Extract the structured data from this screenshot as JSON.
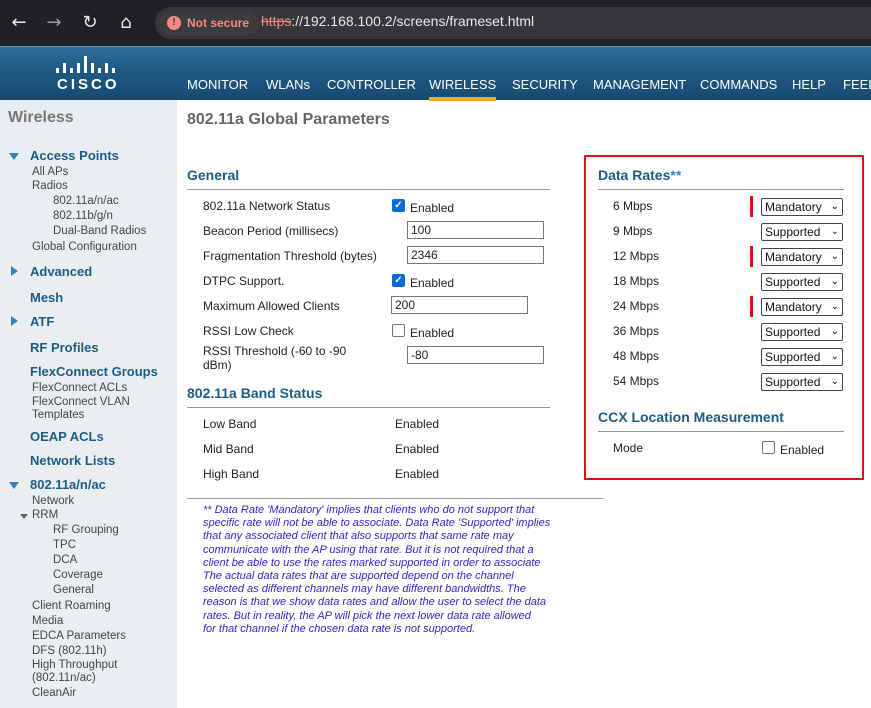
{
  "browser": {
    "not_secure": "Not secure",
    "url_scheme": "https",
    "url_rest": "://192.168.100.2/screens/frameset.html"
  },
  "logo_text": "CISCO",
  "topnav": [
    "MONITOR",
    "WLANs",
    "CONTROLLER",
    "WIRELESS",
    "SECURITY",
    "MANAGEMENT",
    "COMMANDS",
    "HELP",
    "FEED"
  ],
  "topnav_active": "WIRELESS",
  "sidebar": {
    "title": "Wireless",
    "access_points": "Access Points",
    "all_aps": "All APs",
    "radios": "Radios",
    "radio_a": "802.11a/n/ac",
    "radio_b": "802.11b/g/n",
    "radio_dual": "Dual-Band Radios",
    "global_config": "Global Configuration",
    "advanced": "Advanced",
    "mesh": "Mesh",
    "atf": "ATF",
    "rf_profiles": "RF Profiles",
    "flexconnect_groups": "FlexConnect Groups",
    "flexconnect_acls": "FlexConnect ACLs",
    "flexconnect_vlan": "FlexConnect VLAN",
    "templates": "Templates",
    "oeap_acls": "OEAP ACLs",
    "network_lists": "Network Lists",
    "band_a": "802.11a/n/ac",
    "network": "Network",
    "rrm": "RRM",
    "rf_grouping": "RF Grouping",
    "tpc": "TPC",
    "dca": "DCA",
    "coverage": "Coverage",
    "general": "General",
    "client_roaming": "Client Roaming",
    "media": "Media",
    "edca": "EDCA Parameters",
    "dfs": "DFS (802.11h)",
    "ht1": "High Throughput",
    "ht2": "(802.11n/ac)",
    "cleanair": "CleanAir"
  },
  "main": {
    "title": "802.11a Global Parameters",
    "general": {
      "heading": "General",
      "network_status_label": "802.11a Network Status",
      "network_status_text": "Enabled",
      "beacon_label": "Beacon Period (millisecs)",
      "beacon_value": "100",
      "frag_label": "Fragmentation Threshold (bytes)",
      "frag_value": "2346",
      "dtpc_label": "DTPC Support.",
      "dtpc_text": "Enabled",
      "max_clients_label": "Maximum Allowed Clients",
      "max_clients_value": "200",
      "rssi_low_label": "RSSI Low Check",
      "rssi_low_text": "Enabled",
      "rssi_thresh_label1": "RSSI Threshold (-60 to -90",
      "rssi_thresh_label2": "dBm)",
      "rssi_thresh_value": "-80"
    },
    "band_status": {
      "heading": "802.11a Band Status",
      "rows": [
        {
          "label": "Low Band",
          "value": "Enabled"
        },
        {
          "label": "Mid Band",
          "value": "Enabled"
        },
        {
          "label": "High Band",
          "value": "Enabled"
        }
      ]
    },
    "data_rates": {
      "heading": "Data Rates",
      "heading_suffix": "**",
      "rows": [
        {
          "rate": "6 Mbps",
          "value": "Mandatory"
        },
        {
          "rate": "9 Mbps",
          "value": "Supported"
        },
        {
          "rate": "12 Mbps",
          "value": "Mandatory"
        },
        {
          "rate": "18 Mbps",
          "value": "Supported"
        },
        {
          "rate": "24 Mbps",
          "value": "Mandatory"
        },
        {
          "rate": "36 Mbps",
          "value": "Supported"
        },
        {
          "rate": "48 Mbps",
          "value": "Supported"
        },
        {
          "rate": "54 Mbps",
          "value": "Supported"
        }
      ]
    },
    "ccx": {
      "heading": "CCX Location Measurement",
      "mode_label": "Mode",
      "mode_text": "Enabled"
    },
    "note_lines": [
      "** Data Rate 'Mandatory' implies that clients who do not support that",
      "specific rate will not be able to associate. Data Rate 'Supported' implies",
      "that any associated client that also supports that same rate may",
      "communicate with the AP using that rate. But it is not required that a",
      "client be able to use the rates marked supported in order to associate",
      "The actual data rates that are supported depend on the channel",
      "selected as different channels may have different bandwidths. The",
      "reason is that we show data rates and allow the user to select the data",
      "rates. But in reality, the AP will pick the next lower data rate allowed",
      "for that channel if the chosen data rate is not supported."
    ]
  }
}
